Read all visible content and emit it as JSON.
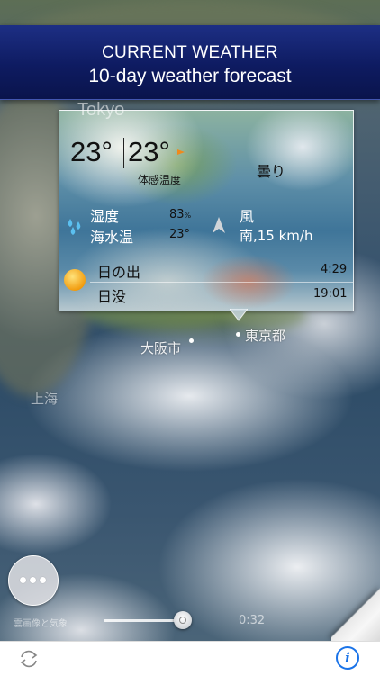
{
  "banner": {
    "line1": "CURRENT WEATHER",
    "line2": "10-day weather forecast"
  },
  "popup": {
    "city_faded": "Tokyo",
    "temp_actual": "23°",
    "temp_feels": "23°",
    "feels_label": "体感温度",
    "condition": "曇り",
    "humidity_label": "湿度",
    "humidity_value": "83",
    "humidity_unit": "%",
    "sea_temp_label": "海水温",
    "sea_temp_value": "23°",
    "wind_label": "風",
    "wind_value": "南,15 km/h",
    "sunrise_label": "日の出",
    "sunrise_value": "4:29",
    "sunset_label": "日没",
    "sunset_value": "19:01"
  },
  "map": {
    "city_osaka": "大阪市",
    "city_tokyo": "東京都",
    "city_shanghai": "上海"
  },
  "controls": {
    "time": "0:32",
    "caption": "雲画像と気象"
  },
  "colors": {
    "banner": "#0e1b61",
    "accent": "#1a73e8",
    "flag": "#f08a1c"
  }
}
